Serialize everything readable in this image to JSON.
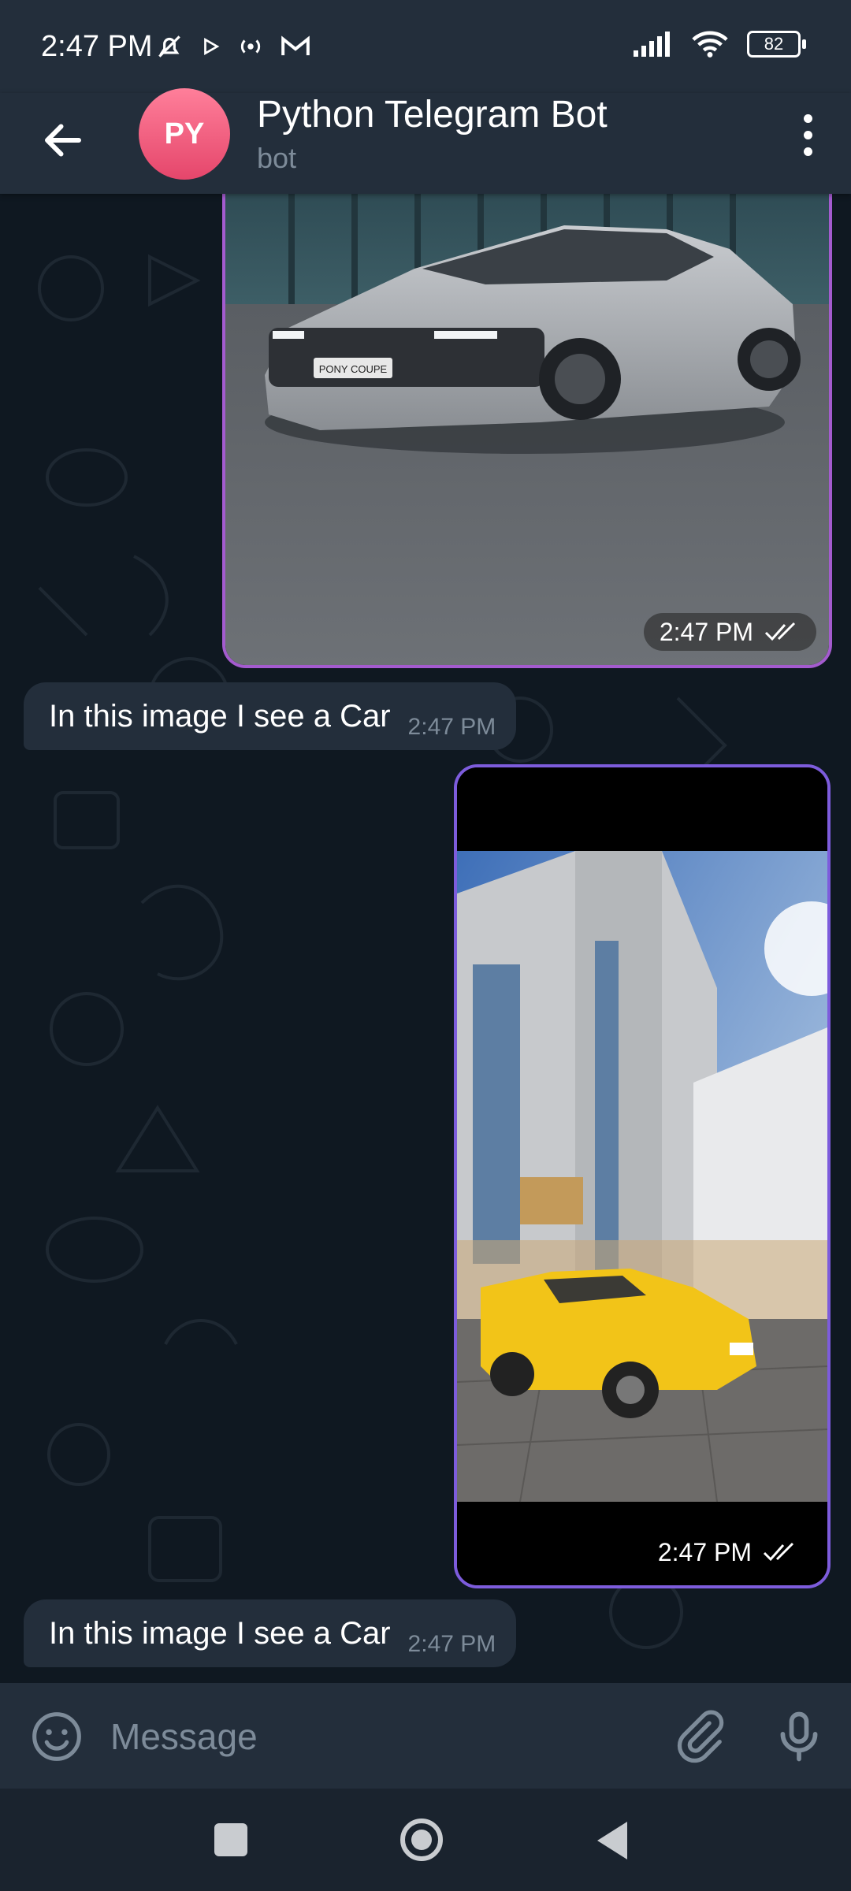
{
  "status_bar": {
    "time": "2:47 PM",
    "battery": "82",
    "icons": [
      "bell-muted-icon",
      "play-icon",
      "radio-icon",
      "gmail-icon",
      "signal-icon",
      "wifi-icon",
      "battery-icon"
    ]
  },
  "header": {
    "avatar_initials": "PY",
    "title": "Python Telegram Bot",
    "subtitle": "bot"
  },
  "messages": [
    {
      "type": "image",
      "direction": "outgoing",
      "image_description": "silver concept coupe",
      "plate_text": "PONY COUPE",
      "time": "2:47 PM"
    },
    {
      "type": "text",
      "direction": "incoming",
      "text": "In this image I see a Car",
      "time": "2:47 PM"
    },
    {
      "type": "image",
      "direction": "outgoing",
      "image_description": "yellow sports car by building",
      "time": "2:47 PM"
    },
    {
      "type": "text",
      "direction": "incoming",
      "text": "In this image I see a Car",
      "time": "2:47 PM"
    }
  ],
  "input": {
    "placeholder": "Message"
  },
  "colors": {
    "background": "#0f1821",
    "bar": "#232e3b",
    "accent_avatar": "#e5466b",
    "bubble_border": "#9a5ad8",
    "secondary_text": "#7d8b99"
  }
}
